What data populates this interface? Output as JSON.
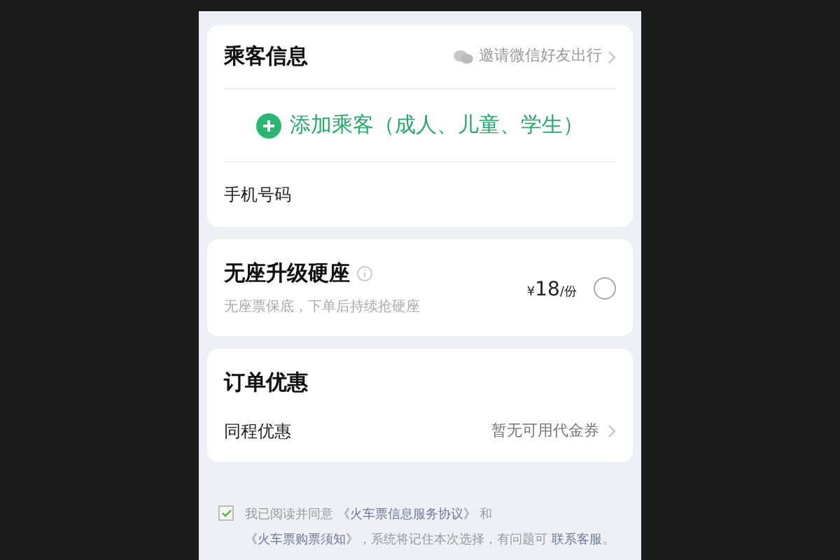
{
  "passenger": {
    "title": "乘客信息",
    "invite": "邀请微信好友出行",
    "add_button": "添加乘客（成人、儿童、学生）",
    "phone_label": "手机号码"
  },
  "upgrade": {
    "title": "无座升级硬座",
    "subtitle": "无座票保底，下单后持续抢硬座",
    "price": "¥18",
    "unit": "/份",
    "selected": false
  },
  "discount": {
    "title": "订单优惠",
    "row_label": "同程优惠",
    "row_value": "暂无可用代金券"
  },
  "agreement": {
    "checked": true,
    "parts": [
      {
        "kind": "text",
        "text": "我已阅读并同意 "
      },
      {
        "kind": "link",
        "text": "《火车票信息服务协议》"
      },
      {
        "kind": "text",
        "text": " 和 "
      },
      {
        "kind": "link",
        "text": "《火车票购票须知》"
      },
      {
        "kind": "text",
        "text": "，系统将记住本次选择，有问题可 "
      },
      {
        "kind": "link",
        "text": "联系客服"
      },
      {
        "kind": "text",
        "text": "。"
      }
    ]
  }
}
